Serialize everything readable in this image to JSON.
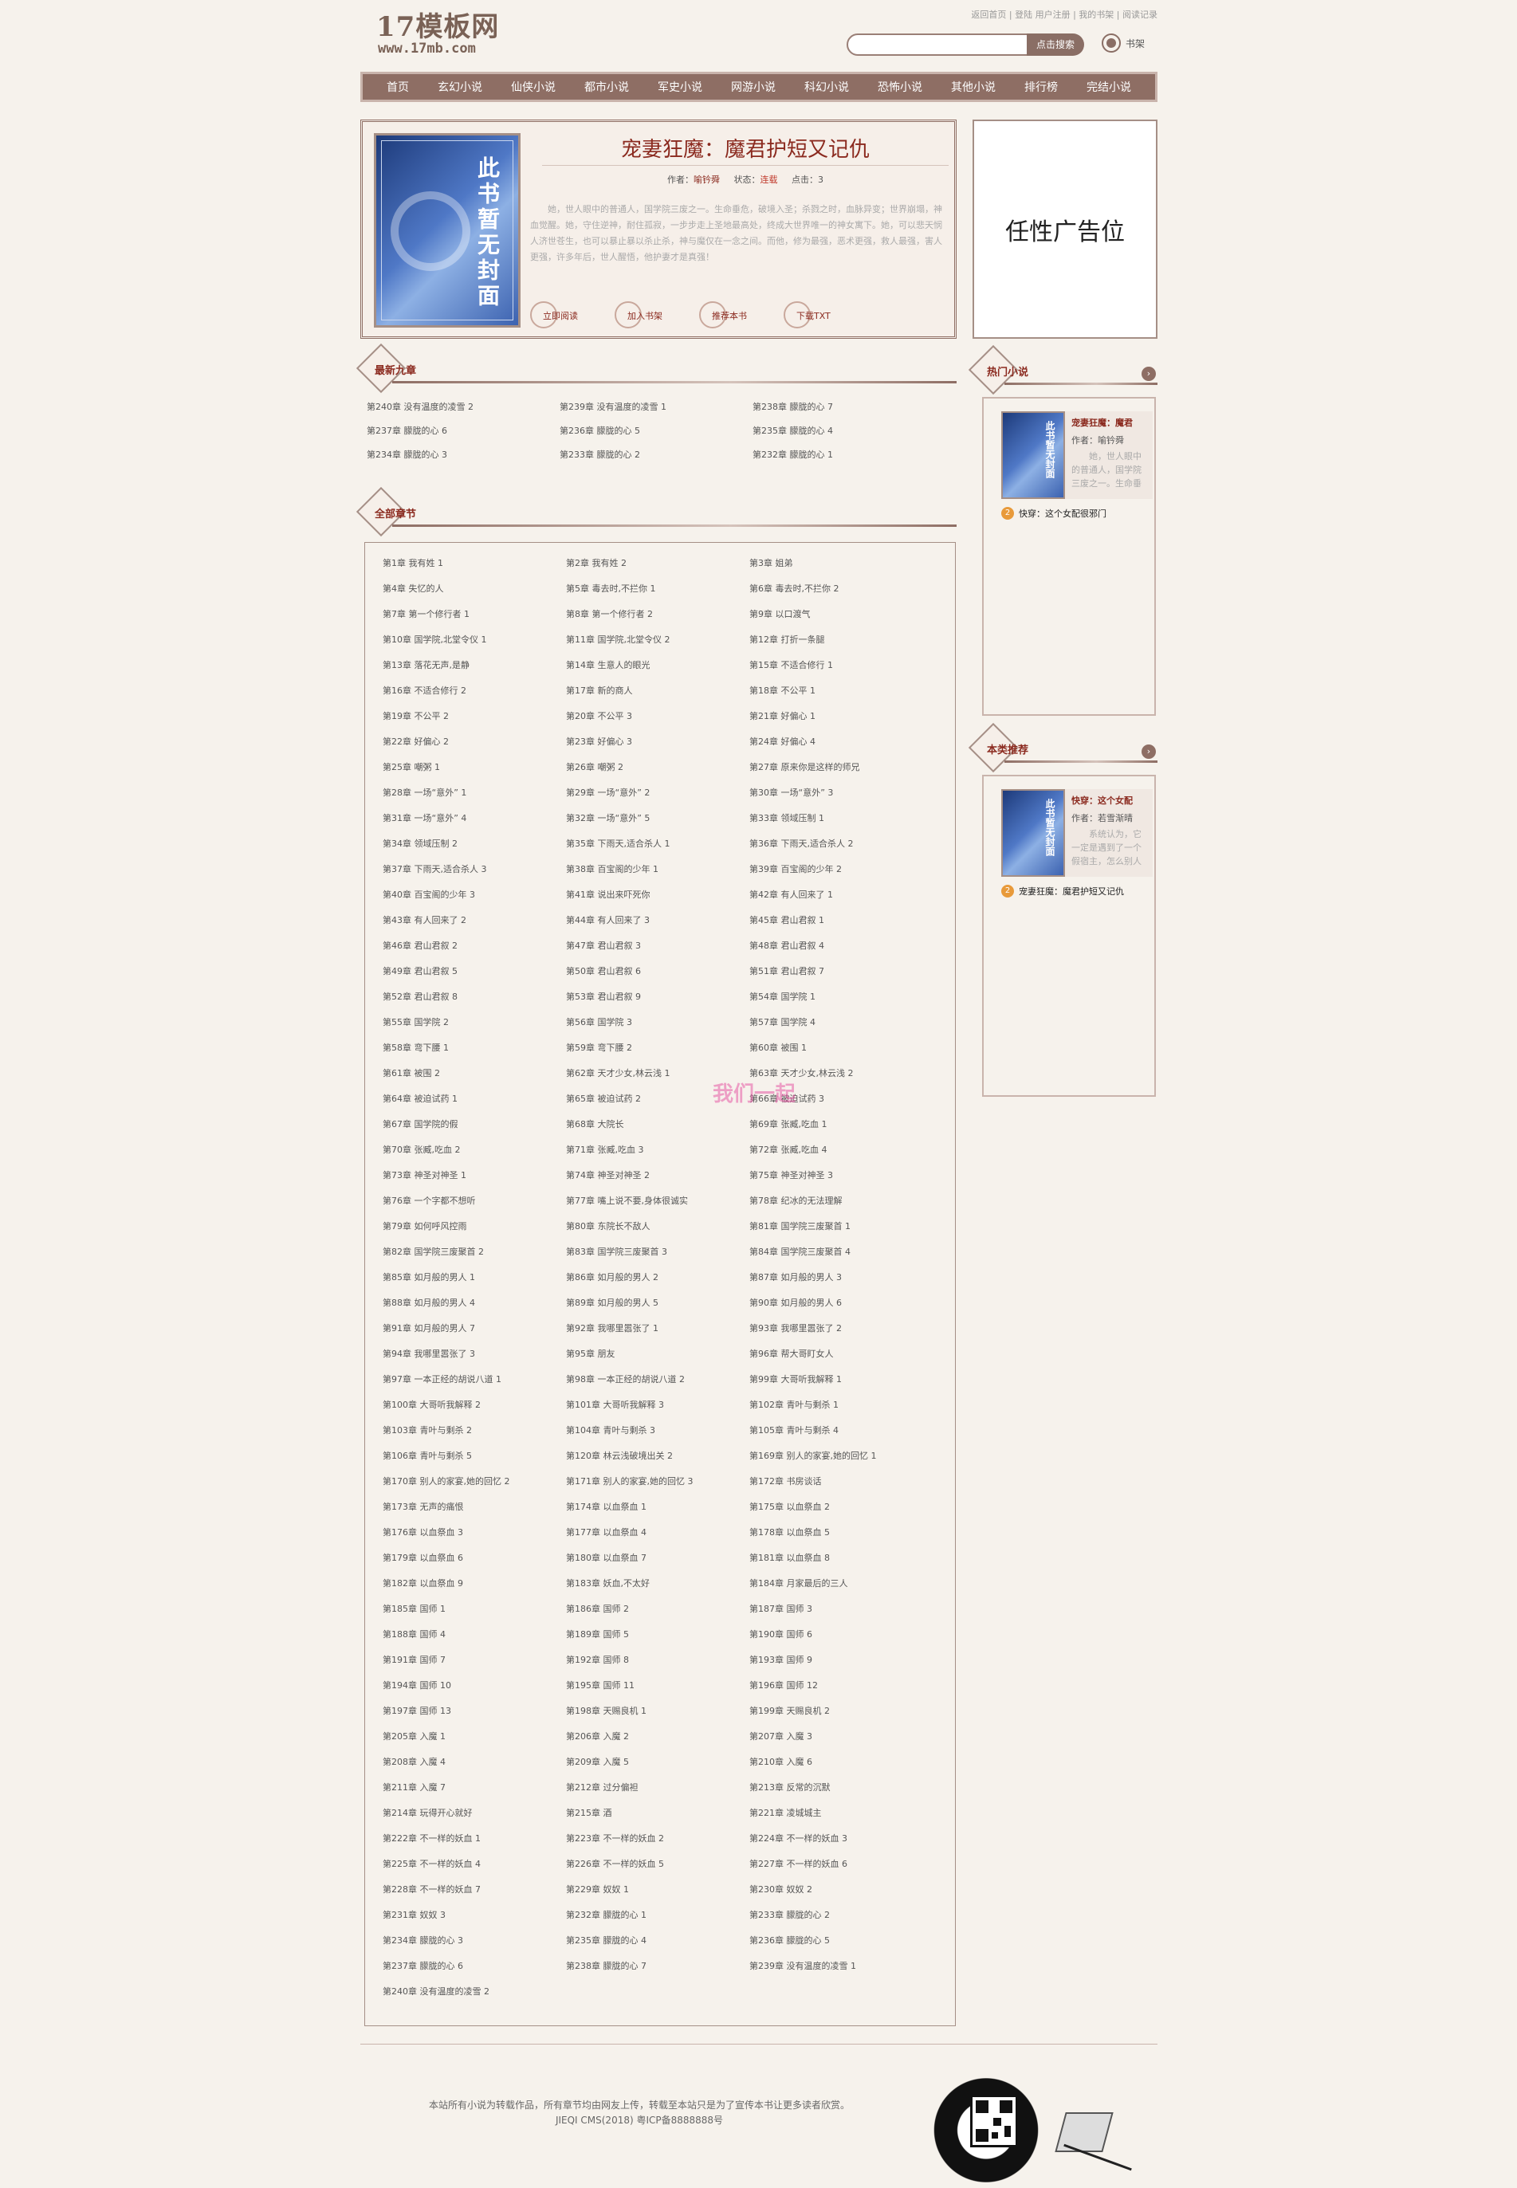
{
  "header": {
    "logo_main": "17模板网",
    "logo_sub": "www.17mb.com",
    "toplinks": [
      "返回首页",
      "登陆",
      "用户注册",
      "我的书架",
      "阅读记录"
    ],
    "search_button": "点击搜索",
    "bookshelf": "书架"
  },
  "nav": [
    "首页",
    "玄幻小说",
    "仙侠小说",
    "都市小说",
    "军史小说",
    "网游小说",
    "科幻小说",
    "恐怖小说",
    "其他小说",
    "排行榜",
    "完结小说"
  ],
  "book": {
    "cover_text": "此书暂无封面",
    "title": "宠妻狂魔：魔君护短又记仇",
    "author_label": "作者：",
    "author": "喻钤舜",
    "status_label": "状态：",
    "status": "连载",
    "clicks_label": "点击：",
    "clicks": "3",
    "intro": "她，世人眼中的普通人，国学院三废之一。生命垂危，破境入圣；杀戮之时，血脉异变；世界崩塌，神血觉醒。她，守住逆神，耐住孤寂，一步步走上圣地最高处，终成大世界唯一的神女寓下。她，可以悲天悯人济世苍生，也可以暴止暴以杀止杀，神与魔仅在一念之间。而他，修为最强，恶术更强，救人最强，害人更强，许多年后，世人醒悟，他护妻才是真强！",
    "actions": [
      "立即阅读",
      "加入书架",
      "推荐本书",
      "下载TXT"
    ]
  },
  "ad_text": "任性广告位",
  "sections": {
    "latest": "最新九章",
    "all": "全部章节",
    "hot": "热门小说",
    "recommend": "本类推荐"
  },
  "latest_chapters": [
    "第240章 没有温度的凌雪 2",
    "第239章 没有温度的凌雪 1",
    "第238章 朦胧的心 7",
    "第237章 朦胧的心 6",
    "第236章 朦胧的心 5",
    "第235章 朦胧的心 4",
    "第234章 朦胧的心 3",
    "第233章 朦胧的心 2",
    "第232章 朦胧的心 1"
  ],
  "chapters": [
    "第1章 我有姓 1",
    "第2章 我有姓 2",
    "第3章 姐弟",
    "第4章 失忆的人",
    "第5章 毒去时,不拦你 1",
    "第6章 毒去时,不拦你 2",
    "第7章 第一个修行者 1",
    "第8章 第一个修行者 2",
    "第9章 以口渡气",
    "第10章 国学院,北堂令仪 1",
    "第11章 国学院,北堂令仪 2",
    "第12章 打折一条腿",
    "第13章 落花无声,是静",
    "第14章 生意人的眼光",
    "第15章 不适合修行 1",
    "第16章 不适合修行 2",
    "第17章 新的商人",
    "第18章 不公平 1",
    "第19章 不公平 2",
    "第20章 不公平 3",
    "第21章 好偏心 1",
    "第22章 好偏心 2",
    "第23章 好偏心 3",
    "第24章 好偏心 4",
    "第25章 嘲粥 1",
    "第26章 嘲粥 2",
    "第27章 原来你是这样的师兄",
    "第28章 一场“意外” 1",
    "第29章 一场“意外” 2",
    "第30章 一场“意外” 3",
    "第31章 一场“意外” 4",
    "第32章 一场“意外” 5",
    "第33章 领域压制 1",
    "第34章 领域压制 2",
    "第35章 下雨天,适合杀人 1",
    "第36章 下雨天,适合杀人 2",
    "第37章 下雨天,适合杀人 3",
    "第38章 百宝阁的少年 1",
    "第39章 百宝阁的少年 2",
    "第40章 百宝阁的少年 3",
    "第41章 说出来吓死你",
    "第42章 有人回来了 1",
    "第43章 有人回来了 2",
    "第44章 有人回来了 3",
    "第45章 君山君叙 1",
    "第46章 君山君叙 2",
    "第47章 君山君叙 3",
    "第48章 君山君叙 4",
    "第49章 君山君叙 5",
    "第50章 君山君叙 6",
    "第51章 君山君叙 7",
    "第52章 君山君叙 8",
    "第53章 君山君叙 9",
    "第54章 国学院 1",
    "第55章 国学院 2",
    "第56章 国学院 3",
    "第57章 国学院 4",
    "第58章 弯下腰 1",
    "第59章 弯下腰 2",
    "第60章 被围 1",
    "第61章 被围 2",
    "第62章 天才少女,林云浅 1",
    "第63章 天才少女,林云浅 2",
    "第64章 被迫试药 1",
    "第65章 被迫试药 2",
    "第66章 被迫试药 3",
    "第67章 国学院的假",
    "第68章 大院长",
    "第69章 张臧,吃血 1",
    "第70章 张臧,吃血 2",
    "第71章 张臧,吃血 3",
    "第72章 张臧,吃血 4",
    "第73章 神圣对神圣 1",
    "第74章 神圣对神圣 2",
    "第75章 神圣对神圣 3",
    "第76章 一个字都不想听",
    "第77章 嘴上说不要,身体很诚实",
    "第78章 纪冰的无法理解",
    "第79章 如何呼风控雨",
    "第80章 东院长不敌人",
    "第81章 国学院三废聚首 1",
    "第82章 国学院三废聚首 2",
    "第83章 国学院三废聚首 3",
    "第84章 国学院三废聚首 4",
    "第85章 如月般的男人 1",
    "第86章 如月般的男人 2",
    "第87章 如月般的男人 3",
    "第88章 如月般的男人 4",
    "第89章 如月般的男人 5",
    "第90章 如月般的男人 6",
    "第91章 如月般的男人 7",
    "第92章 我哪里嚣张了 1",
    "第93章 我哪里嚣张了 2",
    "第94章 我哪里嚣张了 3",
    "第95章 朋友",
    "第96章 帮大哥盯女人",
    "第97章 一本正经的胡说八道 1",
    "第98章 一本正经的胡说八道 2",
    "第99章 大哥听我解释 1",
    "第100章 大哥听我解释 2",
    "第101章 大哥听我解释 3",
    "第102章 青叶与剩杀 1",
    "第103章 青叶与剩杀 2",
    "第104章 青叶与剩杀 3",
    "第105章 青叶与剩杀 4",
    "第106章 青叶与剩杀 5",
    "第120章 林云浅破境出关 2",
    "第169章 别人的家宴,她的回忆 1",
    "第170章 别人的家宴,她的回忆 2",
    "第171章 别人的家宴,她的回忆 3",
    "第172章 书房谈话",
    "第173章 无声的痛恨",
    "第174章 以血祭血 1",
    "第175章 以血祭血 2",
    "第176章 以血祭血 3",
    "第177章 以血祭血 4",
    "第178章 以血祭血 5",
    "第179章 以血祭血 6",
    "第180章 以血祭血 7",
    "第181章 以血祭血 8",
    "第182章 以血祭血 9",
    "第183章 妖血,不太好",
    "第184章 月家最后的三人",
    "第185章 国师 1",
    "第186章 国师 2",
    "第187章 国师 3",
    "第188章 国师 4",
    "第189章 国师 5",
    "第190章 国师 6",
    "第191章 国师 7",
    "第192章 国师 8",
    "第193章 国师 9",
    "第194章 国师 10",
    "第195章 国师 11",
    "第196章 国师 12",
    "第197章 国师 13",
    "第198章 天赐良机 1",
    "第199章 天赐良机 2",
    "第205章 入魔 1",
    "第206章 入魔 2",
    "第207章 入魔 3",
    "第208章 入魔 4",
    "第209章 入魔 5",
    "第210章 入魔 6",
    "第211章 入魔 7",
    "第212章 过分偏袒",
    "第213章 反常的沉默",
    "第214章 玩得开心就好",
    "第215章 酒",
    "第221章 凌城城主",
    "第222章 不一样的妖血 1",
    "第223章 不一样的妖血 2",
    "第224章 不一样的妖血 3",
    "第225章 不一样的妖血 4",
    "第226章 不一样的妖血 5",
    "第227章 不一样的妖血 6",
    "第228章 不一样的妖血 7",
    "第229章 奴奴 1",
    "第230章 奴奴 2",
    "第231章 奴奴 3",
    "第232章 朦胧的心 1",
    "第233章 朦胧的心 2",
    "第234章 朦胧的心 3",
    "第235章 朦胧的心 4",
    "第236章 朦胧的心 5",
    "第237章 朦胧的心 6",
    "第238章 朦胧的心 7",
    "第239章 没有温度的凌雪 1",
    "第240章 没有温度的凌雪 2"
  ],
  "hot": {
    "cover_text": "此书暂无封面",
    "title": "宠妻狂魔：魔君",
    "author": "作者：喻钤舜",
    "desc": "她，世人眼中的普通人，国学院三废之一。生命垂",
    "rank2_num": "2",
    "rank2": "快穿：这个女配很邪门"
  },
  "recommend": {
    "cover_text": "此书暂无封面",
    "title": "快穿：这个女配",
    "author": "作者：若雪渐晴",
    "desc": "系统认为，它一定是遇到了一个假宿主，怎么别人",
    "rank2_num": "2",
    "rank2": "宠妻狂魔：魔君护短又记仇"
  },
  "watermark": "我们一起",
  "footer": {
    "line1": "本站所有小说为转载作品，所有章节均由网友上传，转载至本站只是为了宣传本书让更多读者欣赏。",
    "line2": "JIEQI CMS(2018) 粤ICP备8888888号"
  }
}
